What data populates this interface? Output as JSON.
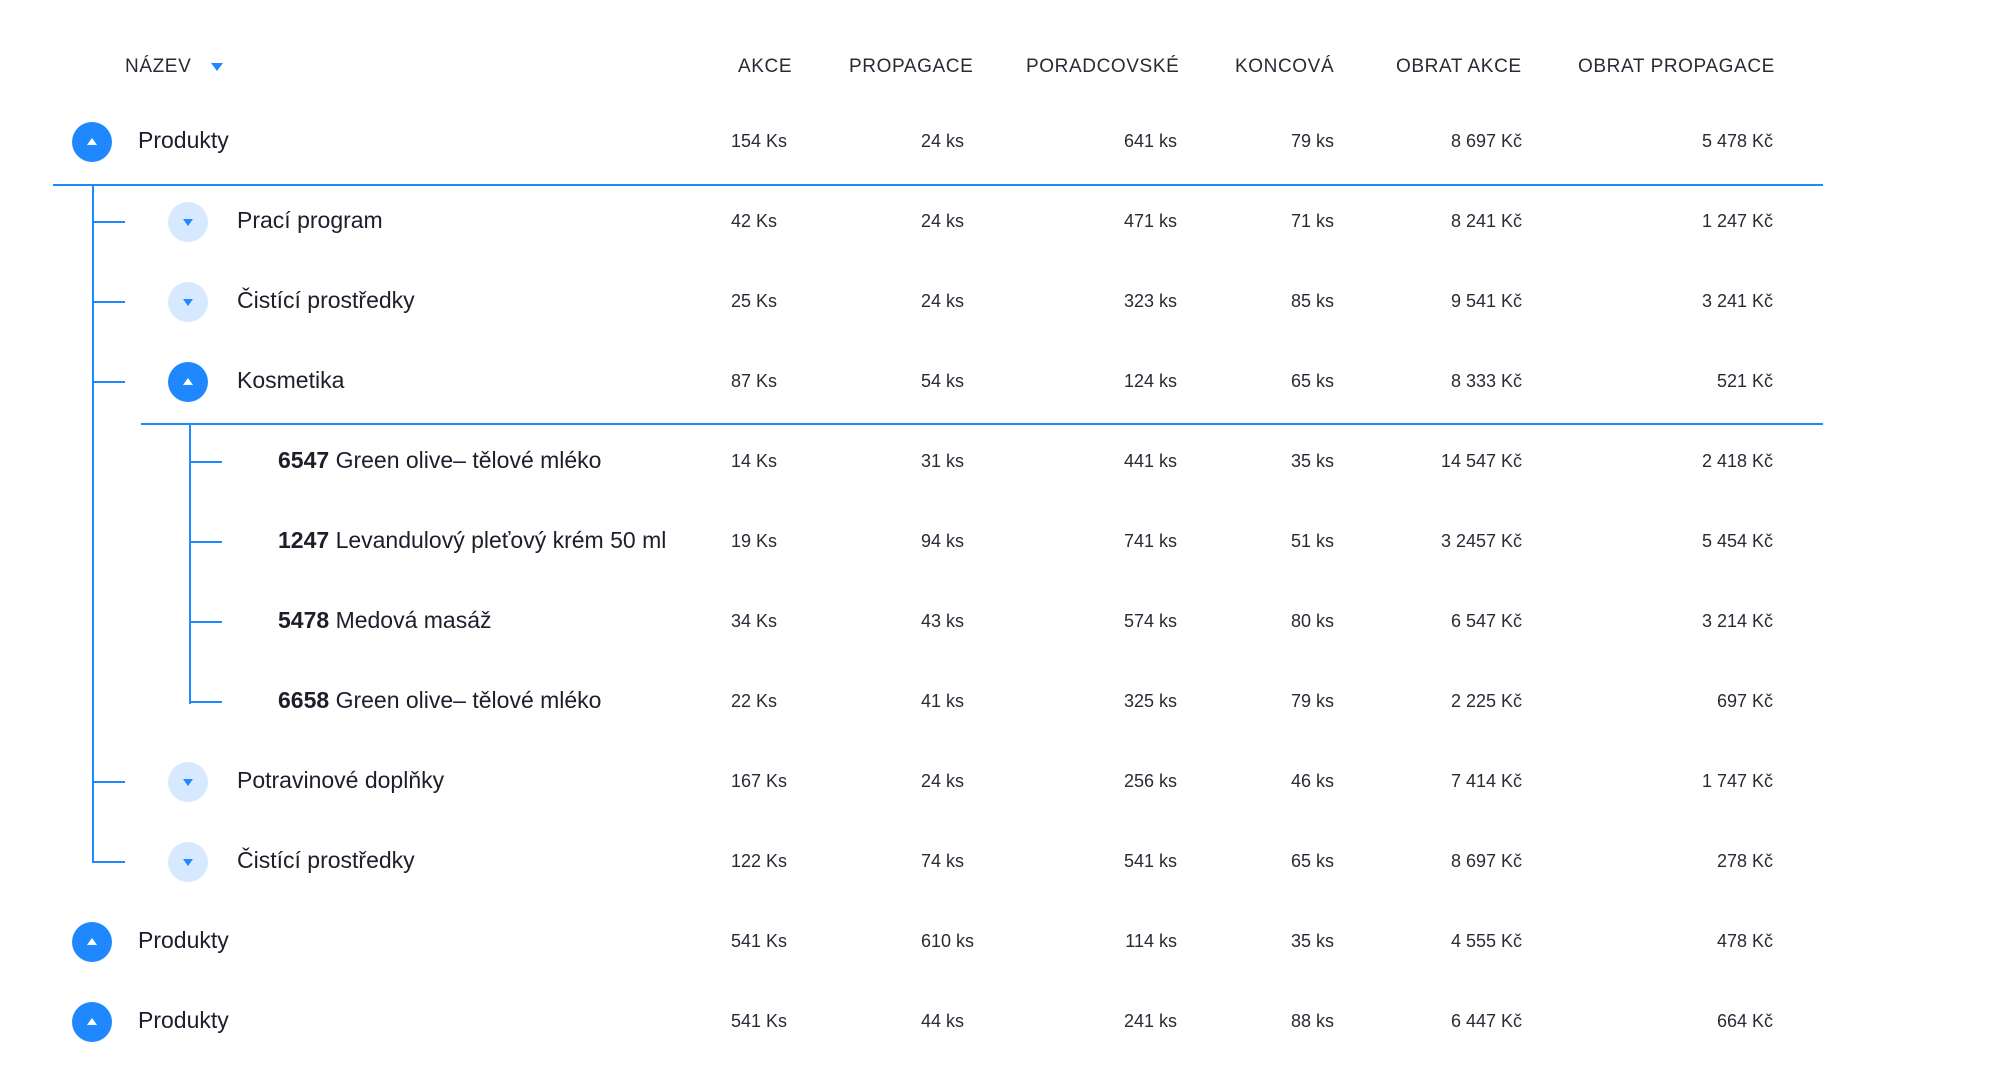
{
  "header": {
    "name": "NÁZEV",
    "akce": "AKCE",
    "propagace": "PROPAGACE",
    "poradcovske": "PORADCOVSKÉ",
    "koncova": "KONCOVÁ",
    "obrat_akce": "OBRAT AKCE",
    "obrat_propagace": "OBRAT PROPAGACE"
  },
  "rows": [
    {
      "level": 0,
      "state": "expanded",
      "name": "Produkty",
      "akce": "154 Ks",
      "propagace": "24 ks",
      "poradcovske": "641 ks",
      "koncova": "79 ks",
      "obrat_akce": "8 697 Kč",
      "obrat_propagace": "5 478 Kč"
    },
    {
      "level": 1,
      "state": "collapsed",
      "name": "Prací program",
      "akce": "42 Ks",
      "propagace": "24 ks",
      "poradcovske": "471 ks",
      "koncova": "71 ks",
      "obrat_akce": "8 241 Kč",
      "obrat_propagace": "1 247 Kč"
    },
    {
      "level": 1,
      "state": "collapsed",
      "name": "Čistící prostředky",
      "akce": "25 Ks",
      "propagace": "24 ks",
      "poradcovske": "323 ks",
      "koncova": "85 ks",
      "obrat_akce": "9 541 Kč",
      "obrat_propagace": "3 241 Kč"
    },
    {
      "level": 1,
      "state": "expanded",
      "name": "Kosmetika",
      "akce": "87 Ks",
      "propagace": "54 ks",
      "poradcovske": "124 ks",
      "koncova": "65 ks",
      "obrat_akce": "8 333 Kč",
      "obrat_propagace": "521 Kč"
    },
    {
      "level": 2,
      "code": "6547",
      "name": "Green olive– tělové mléko",
      "akce": "14 Ks",
      "propagace": "31 ks",
      "poradcovske": "441 ks",
      "koncova": "35 ks",
      "obrat_akce": "14 547 Kč",
      "obrat_propagace": "2 418 Kč"
    },
    {
      "level": 2,
      "code": "1247",
      "name": "Levandulový pleťový krém 50 ml",
      "akce": "19 Ks",
      "propagace": "94 ks",
      "poradcovske": "741 ks",
      "koncova": "51 ks",
      "obrat_akce": "3 2457 Kč",
      "obrat_propagace": "5 454 Kč"
    },
    {
      "level": 2,
      "code": "5478",
      "name": "Medová masáž",
      "akce": "34 Ks",
      "propagace": "43 ks",
      "poradcovske": "574 ks",
      "koncova": "80 ks",
      "obrat_akce": "6 547 Kč",
      "obrat_propagace": "3 214 Kč"
    },
    {
      "level": 2,
      "code": "6658",
      "name": "Green olive– tělové mléko",
      "akce": "22 Ks",
      "propagace": "41 ks",
      "poradcovske": "325 ks",
      "koncova": "79 ks",
      "obrat_akce": "2 225 Kč",
      "obrat_propagace": "697 Kč"
    },
    {
      "level": 1,
      "state": "collapsed",
      "name": "Potravinové doplňky",
      "akce": "167 Ks",
      "propagace": "24 ks",
      "poradcovske": "256 ks",
      "koncova": "46 ks",
      "obrat_akce": "7 414 Kč",
      "obrat_propagace": "1 747 Kč"
    },
    {
      "level": 1,
      "state": "collapsed",
      "name": "Čistící prostředky",
      "akce": "122 Ks",
      "propagace": "74 ks",
      "poradcovske": "541 ks",
      "koncova": "65 ks",
      "obrat_akce": "8 697 Kč",
      "obrat_propagace": "278 Kč"
    },
    {
      "level": 0,
      "state": "expanded",
      "name": "Produkty",
      "akce": "541 Ks",
      "propagace": "610 ks",
      "poradcovske": "114 ks",
      "koncova": "35 ks",
      "obrat_akce": "4 555 Kč",
      "obrat_propagace": "478 Kč"
    },
    {
      "level": 0,
      "state": "expanded",
      "name": "Produkty",
      "akce": "541 Ks",
      "propagace": "44 ks",
      "poradcovske": "241 ks",
      "koncova": "88 ks",
      "obrat_akce": "6 447 Kč",
      "obrat_propagace": "664 Kč"
    }
  ],
  "colors": {
    "accent": "#1f88ff",
    "accent_light": "#d6e9ff",
    "text": "#1d1d2b"
  }
}
